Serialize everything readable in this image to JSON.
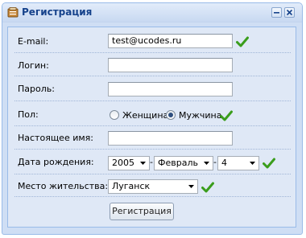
{
  "window": {
    "title": "Регистрация",
    "icon": "form-icon",
    "accent_color": "#15428b"
  },
  "form": {
    "email": {
      "label": "E-mail:",
      "value": "test@ucodes.ru",
      "valid": true
    },
    "login": {
      "label": "Логин:",
      "value": ""
    },
    "password": {
      "label": "Пароль:",
      "value": ""
    },
    "gender": {
      "label": "Пол:",
      "options": [
        "Женщина",
        "Мужчина"
      ],
      "selected": "Мужчина",
      "valid": true
    },
    "real_name": {
      "label": "Настоящее имя:",
      "value": ""
    },
    "birth_date": {
      "label": "Дата рождения:",
      "year": "2005",
      "month": "Февраль",
      "day": "4",
      "separator": "-",
      "valid": true
    },
    "residence": {
      "label": "Место жительства:",
      "value": "Луганск",
      "valid": true
    },
    "submit_label": "Регистрация"
  }
}
